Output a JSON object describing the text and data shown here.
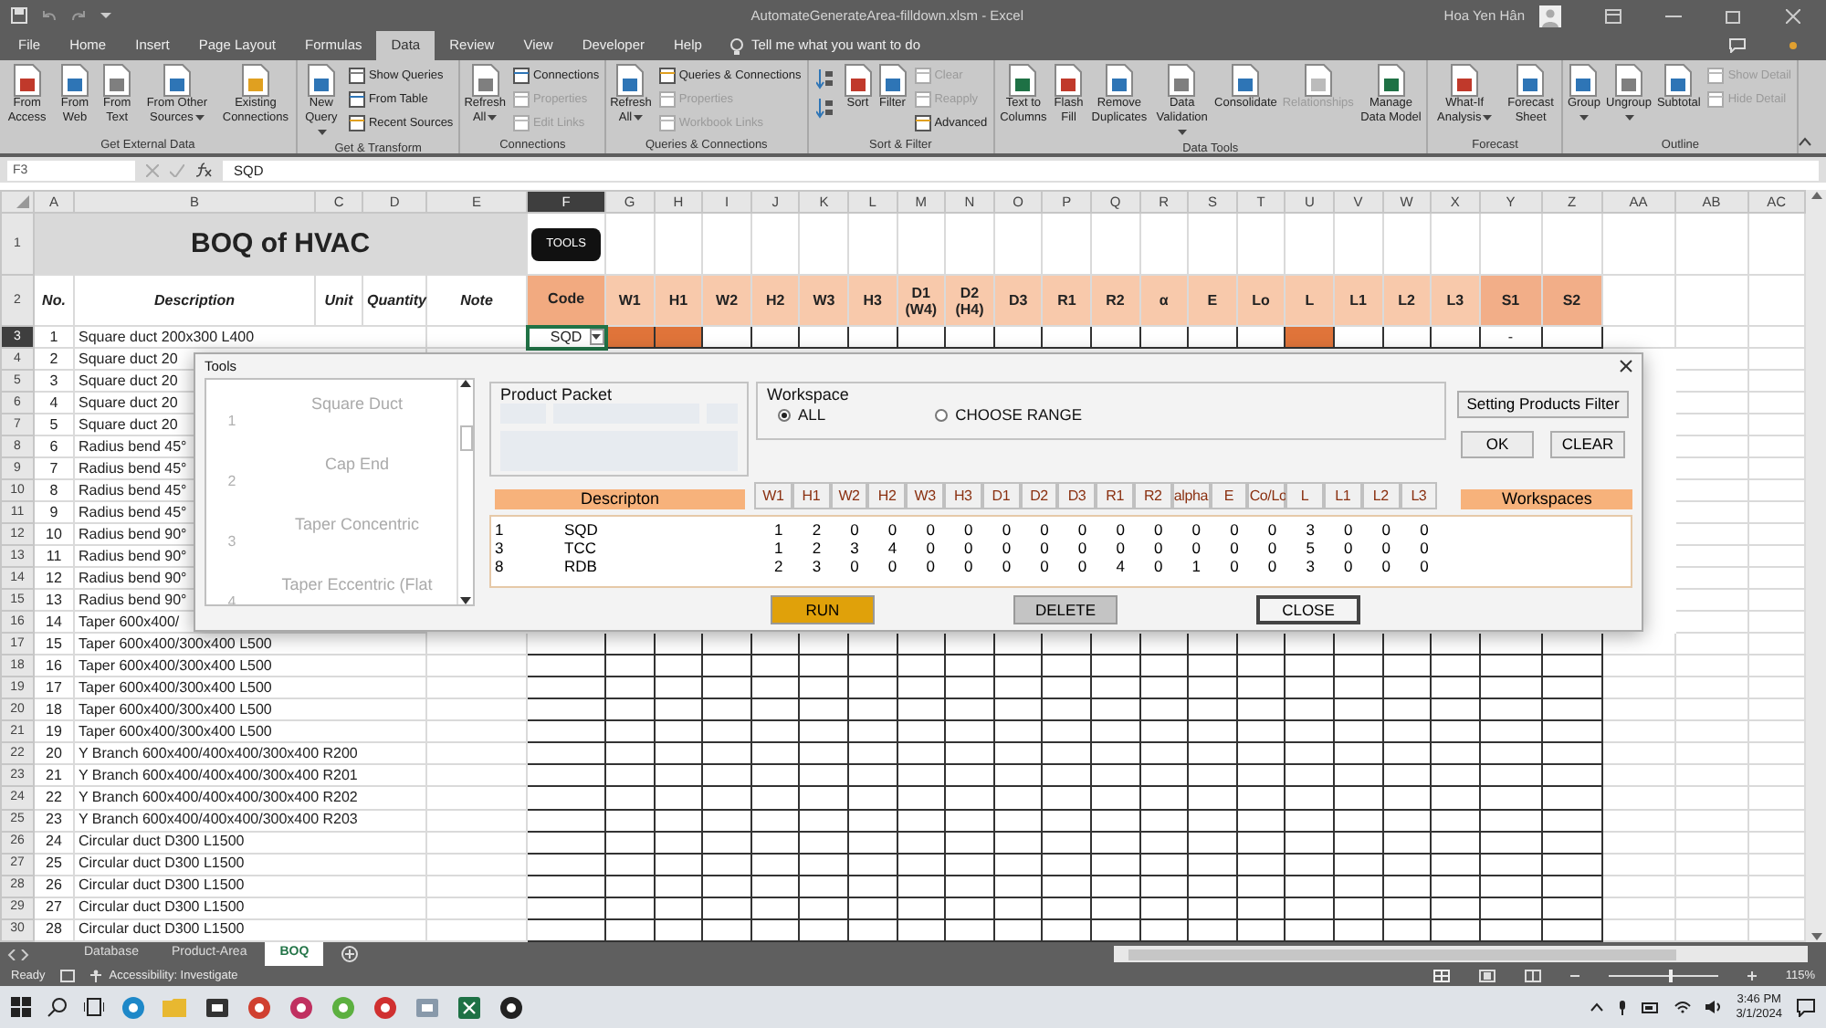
{
  "window": {
    "title": "AutomateGenerateArea-filldown.xlsm  -  Excel",
    "user": "Hoa Yen Hân"
  },
  "menu_tabs": [
    {
      "label": "File",
      "selected": false
    },
    {
      "label": "Home",
      "selected": false
    },
    {
      "label": "Insert",
      "selected": false
    },
    {
      "label": "Page Layout",
      "selected": false
    },
    {
      "label": "Formulas",
      "selected": false
    },
    {
      "label": "Data",
      "selected": true
    },
    {
      "label": "Review",
      "selected": false
    },
    {
      "label": "View",
      "selected": false
    },
    {
      "label": "Developer",
      "selected": false
    },
    {
      "label": "Help",
      "selected": false
    }
  ],
  "tell_me": "Tell me what you want to do",
  "ribbon_groups": [
    {
      "label": "Get External Data",
      "items": [
        {
          "kind": "large",
          "label": "From Access",
          "disabled": false,
          "dropdown": false
        },
        {
          "kind": "large",
          "label": "From Web",
          "disabled": false,
          "dropdown": false
        },
        {
          "kind": "large",
          "label": "From Text",
          "disabled": false,
          "dropdown": false
        },
        {
          "kind": "large",
          "label": "From Other Sources",
          "disabled": false,
          "dropdown": true
        },
        {
          "kind": "large",
          "label": "Existing Connections",
          "disabled": false,
          "dropdown": false
        }
      ]
    },
    {
      "label": "Get & Transform",
      "items": [
        {
          "kind": "large",
          "label": "New Query",
          "disabled": false,
          "dropdown": true
        },
        {
          "kind": "small",
          "label": "Show Queries",
          "disabled": false,
          "dropdown": false
        },
        {
          "kind": "small",
          "label": "From Table",
          "disabled": false,
          "dropdown": false
        },
        {
          "kind": "small",
          "label": "Recent Sources",
          "disabled": false,
          "dropdown": false
        }
      ]
    },
    {
      "label": "Connections",
      "items": [
        {
          "kind": "large",
          "label": "Refresh All",
          "disabled": false,
          "dropdown": true
        },
        {
          "kind": "small",
          "label": "Connections",
          "disabled": false,
          "dropdown": false
        },
        {
          "kind": "small",
          "label": "Properties",
          "disabled": true,
          "dropdown": false
        },
        {
          "kind": "small",
          "label": "Edit Links",
          "disabled": true,
          "dropdown": false
        }
      ]
    },
    {
      "label": "Queries & Connections",
      "items": [
        {
          "kind": "large",
          "label": "Refresh All",
          "disabled": false,
          "dropdown": true
        },
        {
          "kind": "small",
          "label": "Queries & Connections",
          "disabled": false,
          "dropdown": false
        },
        {
          "kind": "small",
          "label": "Properties",
          "disabled": true,
          "dropdown": false
        },
        {
          "kind": "small",
          "label": "Workbook Links",
          "disabled": true,
          "dropdown": false
        }
      ]
    },
    {
      "label": "Sort & Filter",
      "items": [
        {
          "kind": "icon",
          "disabled": false
        },
        {
          "kind": "icon",
          "disabled": false
        },
        {
          "kind": "large",
          "label": "Sort",
          "disabled": false,
          "dropdown": false
        },
        {
          "kind": "large",
          "label": "Filter",
          "disabled": false,
          "dropdown": false
        },
        {
          "kind": "small",
          "label": "Clear",
          "disabled": true,
          "dropdown": false
        },
        {
          "kind": "small",
          "label": "Reapply",
          "disabled": true,
          "dropdown": false
        },
        {
          "kind": "small",
          "label": "Advanced",
          "disabled": false,
          "dropdown": false
        }
      ]
    },
    {
      "label": "Data Tools",
      "items": [
        {
          "kind": "large",
          "label": "Text to Columns",
          "disabled": false,
          "dropdown": false
        },
        {
          "kind": "large",
          "label": "Flash Fill",
          "disabled": false,
          "dropdown": false
        },
        {
          "kind": "large",
          "label": "Remove Duplicates",
          "disabled": false,
          "dropdown": false
        },
        {
          "kind": "large",
          "label": "Data Validation",
          "disabled": false,
          "dropdown": true
        },
        {
          "kind": "large",
          "label": "Consolidate",
          "disabled": false,
          "dropdown": false
        },
        {
          "kind": "large",
          "label": "Relationships",
          "disabled": true,
          "dropdown": false
        },
        {
          "kind": "large",
          "label": "Manage Data Model",
          "disabled": false,
          "dropdown": false
        }
      ]
    },
    {
      "label": "Forecast",
      "items": [
        {
          "kind": "large",
          "label": "What-If Analysis",
          "disabled": false,
          "dropdown": true
        },
        {
          "kind": "large",
          "label": "Forecast Sheet",
          "disabled": false,
          "dropdown": false
        }
      ]
    },
    {
      "label": "Outline",
      "items": [
        {
          "kind": "large",
          "label": "Group",
          "disabled": false,
          "dropdown": true
        },
        {
          "kind": "large",
          "label": "Ungroup",
          "disabled": false,
          "dropdown": true
        },
        {
          "kind": "large",
          "label": "Subtotal",
          "disabled": false,
          "dropdown": false
        },
        {
          "kind": "small",
          "label": "Show Detail",
          "disabled": true,
          "dropdown": false
        },
        {
          "kind": "small",
          "label": "Hide Detail",
          "disabled": true,
          "dropdown": false
        }
      ]
    }
  ],
  "formula_bar": {
    "name_box": "F3",
    "formula": "SQD"
  },
  "sheet": {
    "columns": [
      {
        "label": "A",
        "selected": false
      },
      {
        "label": "B",
        "selected": false
      },
      {
        "label": "C",
        "selected": false
      },
      {
        "label": "D",
        "selected": false
      },
      {
        "label": "E",
        "selected": false
      },
      {
        "label": "F",
        "selected": true
      },
      {
        "label": "G",
        "selected": false
      },
      {
        "label": "H",
        "selected": false
      },
      {
        "label": "I",
        "selected": false
      },
      {
        "label": "J",
        "selected": false
      },
      {
        "label": "K",
        "selected": false
      },
      {
        "label": "L",
        "selected": false
      },
      {
        "label": "M",
        "selected": false
      },
      {
        "label": "N",
        "selected": false
      },
      {
        "label": "O",
        "selected": false
      },
      {
        "label": "P",
        "selected": false
      },
      {
        "label": "Q",
        "selected": false
      },
      {
        "label": "R",
        "selected": false
      },
      {
        "label": "S",
        "selected": false
      },
      {
        "label": "T",
        "selected": false
      },
      {
        "label": "U",
        "selected": false
      },
      {
        "label": "V",
        "selected": false
      },
      {
        "label": "W",
        "selected": false
      },
      {
        "label": "X",
        "selected": false
      },
      {
        "label": "Y",
        "selected": false
      },
      {
        "label": "Z",
        "selected": false
      },
      {
        "label": "AA",
        "selected": false
      },
      {
        "label": "AB",
        "selected": false
      },
      {
        "label": "AC",
        "selected": false
      }
    ],
    "title": "BOQ of HVAC",
    "tools_button": "TOOLS",
    "headers": [
      {
        "label": "No.",
        "kind": "plain"
      },
      {
        "label": "Description",
        "kind": "plain"
      },
      {
        "label": "Unit",
        "kind": "plain"
      },
      {
        "label": "Quantity",
        "kind": "plain"
      },
      {
        "label": "Note",
        "kind": "plain"
      },
      {
        "label": "Code",
        "kind": "code"
      },
      {
        "label": "W1",
        "kind": "param"
      },
      {
        "label": "H1",
        "kind": "param"
      },
      {
        "label": "W2",
        "kind": "param"
      },
      {
        "label": "H2",
        "kind": "param"
      },
      {
        "label": "W3",
        "kind": "param"
      },
      {
        "label": "H3",
        "kind": "param"
      },
      {
        "label": "D1 (W4)",
        "kind": "param"
      },
      {
        "label": "D2 (H4)",
        "kind": "param"
      },
      {
        "label": "D3",
        "kind": "param"
      },
      {
        "label": "R1",
        "kind": "param"
      },
      {
        "label": "R2",
        "kind": "param"
      },
      {
        "label": "α",
        "kind": "param"
      },
      {
        "label": "E",
        "kind": "param"
      },
      {
        "label": "Lo",
        "kind": "param"
      },
      {
        "label": "L",
        "kind": "param"
      },
      {
        "label": "L1",
        "kind": "param"
      },
      {
        "label": "L2",
        "kind": "param"
      },
      {
        "label": "L3",
        "kind": "param"
      },
      {
        "label": "S1",
        "kind": "extra"
      },
      {
        "label": "S2",
        "kind": "extra"
      }
    ],
    "row_numbers": [
      {
        "label": "1",
        "selected": false
      },
      {
        "label": "2",
        "selected": false
      },
      {
        "label": "3",
        "selected": true
      },
      {
        "label": "4",
        "selected": false
      },
      {
        "label": "5",
        "selected": false
      },
      {
        "label": "6",
        "selected": false
      },
      {
        "label": "7",
        "selected": false
      },
      {
        "label": "8",
        "selected": false
      },
      {
        "label": "9",
        "selected": false
      },
      {
        "label": "10",
        "selected": false
      },
      {
        "label": "11",
        "selected": false
      },
      {
        "label": "12",
        "selected": false
      },
      {
        "label": "13",
        "selected": false
      },
      {
        "label": "14",
        "selected": false
      },
      {
        "label": "15",
        "selected": false
      },
      {
        "label": "16",
        "selected": false
      },
      {
        "label": "17",
        "selected": false
      },
      {
        "label": "18",
        "selected": false
      },
      {
        "label": "19",
        "selected": false
      },
      {
        "label": "20",
        "selected": false
      },
      {
        "label": "21",
        "selected": false
      },
      {
        "label": "22",
        "selected": false
      },
      {
        "label": "23",
        "selected": false
      },
      {
        "label": "24",
        "selected": false
      },
      {
        "label": "25",
        "selected": false
      },
      {
        "label": "26",
        "selected": false
      },
      {
        "label": "27",
        "selected": false
      },
      {
        "label": "28",
        "selected": false
      },
      {
        "label": "29",
        "selected": false
      },
      {
        "label": "30",
        "selected": false
      }
    ],
    "rows": [
      {
        "no": "1",
        "description": "Square duct 200x300 L400",
        "code": "SQD",
        "cells": [
          {
            "filled": true
          },
          {
            "filled": true
          },
          {
            "filled": false
          },
          {
            "filled": false
          },
          {
            "filled": false
          },
          {
            "filled": false
          },
          {
            "filled": false
          },
          {
            "filled": false
          },
          {
            "filled": false
          },
          {
            "filled": false
          },
          {
            "filled": false
          },
          {
            "filled": false
          },
          {
            "filled": false
          },
          {
            "filled": false
          },
          {
            "filled": true
          },
          {
            "filled": false
          },
          {
            "filled": false
          },
          {
            "filled": false
          },
          {
            "filled": false,
            "value": "-"
          },
          {
            "filled": false
          }
        ]
      },
      {
        "no": "2",
        "description": "Square duct 20"
      },
      {
        "no": "3",
        "description": "Square duct 20"
      },
      {
        "no": "4",
        "description": "Square duct 20"
      },
      {
        "no": "5",
        "description": "Square duct 20"
      },
      {
        "no": "6",
        "description": "Radius bend 45°"
      },
      {
        "no": "7",
        "description": "Radius bend 45°"
      },
      {
        "no": "8",
        "description": "Radius bend 45°"
      },
      {
        "no": "9",
        "description": "Radius bend 45°"
      },
      {
        "no": "10",
        "description": "Radius bend 90°"
      },
      {
        "no": "11",
        "description": "Radius bend 90°"
      },
      {
        "no": "12",
        "description": "Radius bend 90°"
      },
      {
        "no": "13",
        "description": "Radius bend 90°"
      },
      {
        "no": "14",
        "description": "Taper 600x400/"
      },
      {
        "no": "15",
        "description": "Taper 600x400/300x400 L500"
      },
      {
        "no": "16",
        "description": "Taper 600x400/300x400 L500"
      },
      {
        "no": "17",
        "description": "Taper 600x400/300x400 L500"
      },
      {
        "no": "18",
        "description": "Taper 600x400/300x400 L500"
      },
      {
        "no": "19",
        "description": "Taper 600x400/300x400 L500"
      },
      {
        "no": "20",
        "description": "Y Branch 600x400/400x400/300x400 R200"
      },
      {
        "no": "21",
        "description": "Y Branch 600x400/400x400/300x400 R201"
      },
      {
        "no": "22",
        "description": "Y Branch 600x400/400x400/300x400 R202"
      },
      {
        "no": "23",
        "description": "Y Branch 600x400/400x400/300x400 R203"
      },
      {
        "no": "24",
        "description": "Circular duct D300 L1500"
      },
      {
        "no": "25",
        "description": "Circular duct D300 L1500"
      },
      {
        "no": "26",
        "description": "Circular duct D300 L1500"
      },
      {
        "no": "27",
        "description": "Circular duct D300 L1500"
      },
      {
        "no": "28",
        "description": "Circular duct D300 L1500"
      }
    ]
  },
  "dialog": {
    "title": "Tools",
    "products": [
      {
        "number": "1",
        "label": "Square Duct"
      },
      {
        "number": "2",
        "label": "Cap End"
      },
      {
        "number": "3",
        "label": "Taper Concentric"
      },
      {
        "number": "4",
        "label": "Taper Eccentric (Flat"
      }
    ],
    "product_packet": "Product Packet",
    "workspace": {
      "label": "Workspace",
      "options": [
        {
          "label": "ALL",
          "selected": true
        },
        {
          "label": "CHOOSE RANGE",
          "selected": false
        }
      ]
    },
    "filter_button": "Setting Products Filter",
    "ok_button": "OK",
    "clear_button": "CLEAR",
    "description_header": "Descripton",
    "parameters": [
      "W1",
      "H1",
      "W2",
      "H2",
      "W3",
      "H3",
      "D1",
      "D2",
      "D3",
      "R1",
      "R2",
      "alpha",
      "E",
      "Co/Lo",
      "L",
      "L1",
      "L2",
      "L3"
    ],
    "workspaces_header": "Workspaces",
    "entries": [
      {
        "id": "1",
        "code": "SQD",
        "values": [
          "1",
          "2",
          "0",
          "0",
          "0",
          "0",
          "0",
          "0",
          "0",
          "0",
          "0",
          "0",
          "0",
          "0",
          "3",
          "0",
          "0",
          "0"
        ]
      },
      {
        "id": "3",
        "code": "TCC",
        "values": [
          "1",
          "2",
          "3",
          "4",
          "0",
          "0",
          "0",
          "0",
          "0",
          "0",
          "0",
          "0",
          "0",
          "0",
          "5",
          "0",
          "0",
          "0"
        ]
      },
      {
        "id": "8",
        "code": "RDB",
        "values": [
          "2",
          "3",
          "0",
          "0",
          "0",
          "0",
          "0",
          "0",
          "0",
          "4",
          "0",
          "1",
          "0",
          "0",
          "3",
          "0",
          "0",
          "0"
        ]
      }
    ],
    "actions": [
      {
        "label": "RUN",
        "kind": "run"
      },
      {
        "label": "DELETE",
        "kind": "delete"
      },
      {
        "label": "CLOSE",
        "kind": "close"
      }
    ]
  },
  "sheet_tabs": [
    {
      "label": "Database",
      "selected": false
    },
    {
      "label": "Product-Area",
      "selected": false
    },
    {
      "label": "BOQ",
      "selected": true
    }
  ],
  "status": {
    "mode": "Ready",
    "accessibility": "Accessibility: Investigate",
    "zoom": "115%",
    "zoom_slider": {
      "level": 0.55
    }
  },
  "taskbar": {
    "time": "3:46 PM",
    "date": "3/1/2024"
  }
}
